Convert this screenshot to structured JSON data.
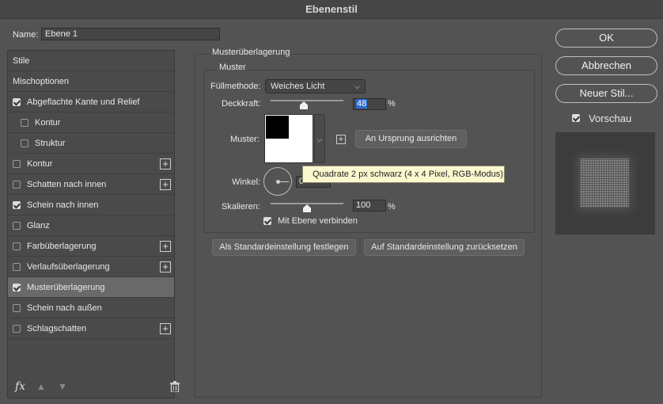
{
  "window": {
    "title": "Ebenenstil"
  },
  "name_field": {
    "label": "Name:",
    "value": "Ebene 1"
  },
  "style_list": {
    "items": [
      {
        "label": "Stile",
        "checkbox": false,
        "checked": false,
        "indent": false,
        "plus": false,
        "selected": false
      },
      {
        "label": "Mischoptionen",
        "checkbox": false,
        "checked": false,
        "indent": false,
        "plus": false,
        "selected": false
      },
      {
        "label": "Abgeflachte Kante und Relief",
        "checkbox": true,
        "checked": true,
        "indent": false,
        "plus": false,
        "selected": false
      },
      {
        "label": "Kontur",
        "checkbox": true,
        "checked": false,
        "indent": true,
        "plus": false,
        "selected": false
      },
      {
        "label": "Struktur",
        "checkbox": true,
        "checked": false,
        "indent": true,
        "plus": false,
        "selected": false
      },
      {
        "label": "Kontur",
        "checkbox": true,
        "checked": false,
        "indent": false,
        "plus": true,
        "selected": false
      },
      {
        "label": "Schatten nach innen",
        "checkbox": true,
        "checked": false,
        "indent": false,
        "plus": true,
        "selected": false
      },
      {
        "label": "Schein nach innen",
        "checkbox": true,
        "checked": true,
        "indent": false,
        "plus": false,
        "selected": false
      },
      {
        "label": "Glanz",
        "checkbox": true,
        "checked": false,
        "indent": false,
        "plus": false,
        "selected": false
      },
      {
        "label": "Farbüberlagerung",
        "checkbox": true,
        "checked": false,
        "indent": false,
        "plus": true,
        "selected": false
      },
      {
        "label": "Verlaufsüberlagerung",
        "checkbox": true,
        "checked": false,
        "indent": false,
        "plus": true,
        "selected": false
      },
      {
        "label": "Musterüberlagerung",
        "checkbox": true,
        "checked": true,
        "indent": false,
        "plus": false,
        "selected": true
      },
      {
        "label": "Schein nach außen",
        "checkbox": true,
        "checked": false,
        "indent": false,
        "plus": false,
        "selected": false
      },
      {
        "label": "Schlagschatten",
        "checkbox": true,
        "checked": false,
        "indent": false,
        "plus": true,
        "selected": false
      }
    ],
    "footer_icons": [
      "fx-icon",
      "arrow-up-icon",
      "arrow-down-icon",
      "trash-icon"
    ],
    "footer_fx": "fx"
  },
  "section": {
    "title": "Musterüberlagerung",
    "group_title": "Muster",
    "blend_mode": {
      "label": "Füllmethode:",
      "value": "Weiches Licht"
    },
    "opacity": {
      "label": "Deckkraft:",
      "value": "48",
      "unit": "%",
      "slider_fraction": 0.48
    },
    "pattern": {
      "label": "Muster:",
      "snap_button": "An Ursprung ausrichten"
    },
    "angle": {
      "label": "Winkel:",
      "value": "0"
    },
    "scale": {
      "label": "Skalieren:",
      "value": "100",
      "unit": "%",
      "slider_fraction": 0.5
    },
    "link_with_layer": {
      "label": "Mit Ebene verbinden",
      "checked": true
    },
    "make_default": "Als Standardeinstellung festlegen",
    "reset_default": "Auf Standardeinstellung zurücksetzen"
  },
  "tooltip": {
    "text": "Quadrate 2 px schwarz (4 x 4 Pixel, RGB-Modus)"
  },
  "right": {
    "ok": "OK",
    "cancel": "Abbrechen",
    "new_style": "Neuer Stil...",
    "preview_label": "Vorschau",
    "preview_checked": true
  },
  "colors": {
    "accent": "#2b6cd4",
    "selected_row": "#696969",
    "tooltip_bg": "#fbf8d0"
  }
}
